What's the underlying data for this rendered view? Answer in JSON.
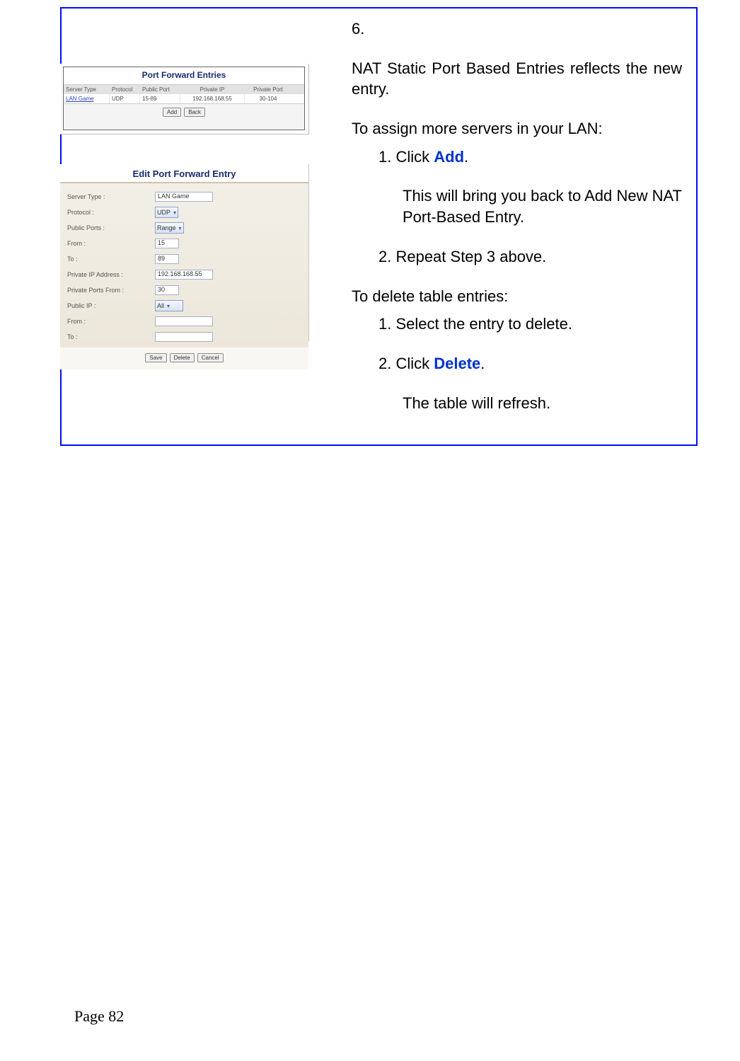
{
  "step_marker": "6.",
  "para1": "NAT Static Port Based Entries reflects the new entry.",
  "assign_heading": "To assign more servers in your LAN:",
  "assign_step1_prefix": "1. Click ",
  "assign_step1_link": "Add",
  "assign_step1_suffix": ".",
  "assign_step1_desc": "This will bring you back to Add New NAT Port-Based Entry.",
  "assign_step2": "2. Repeat Step 3 above.",
  "delete_heading": "To delete table entries:",
  "delete_step1": "1. Select the entry to delete.",
  "delete_step2_prefix": "2. Click ",
  "delete_step2_link": "Delete",
  "delete_step2_suffix": ".",
  "delete_result": "The table will refresh.",
  "page_number": "Page 82",
  "shot1": {
    "title": "Port Forward Entries",
    "headers": {
      "server_type": "Server Type",
      "protocol": "Protocol",
      "public_port": "Public Port",
      "private_ip": "Private IP",
      "private_port": "Private Port"
    },
    "row": {
      "server_type": "LAN Game",
      "protocol": "UDP",
      "public_port": "15-89",
      "private_ip": "192.168.168.55",
      "private_port": "30-104"
    },
    "buttons": {
      "add": "Add",
      "back": "Back"
    }
  },
  "shot2": {
    "title": "Edit Port Forward Entry",
    "labels": {
      "server_type": "Server Type :",
      "protocol": "Protocol :",
      "public_ports": "Public Ports :",
      "from": "From :",
      "to": "To :",
      "private_ip": "Private IP Address :",
      "private_ports_from": "Private Ports From :",
      "public_ip": "Public IP :",
      "from2": "From :",
      "to2": "To :"
    },
    "values": {
      "server_type": "LAN Game",
      "protocol": "UDP",
      "public_ports": "Range",
      "from": "15",
      "to": "89",
      "private_ip": "192.168.168.55",
      "private_ports_from": "30",
      "public_ip": "All",
      "from2": "",
      "to2": ""
    },
    "buttons": {
      "save": "Save",
      "delete": "Delete",
      "cancel": "Cancel"
    }
  }
}
